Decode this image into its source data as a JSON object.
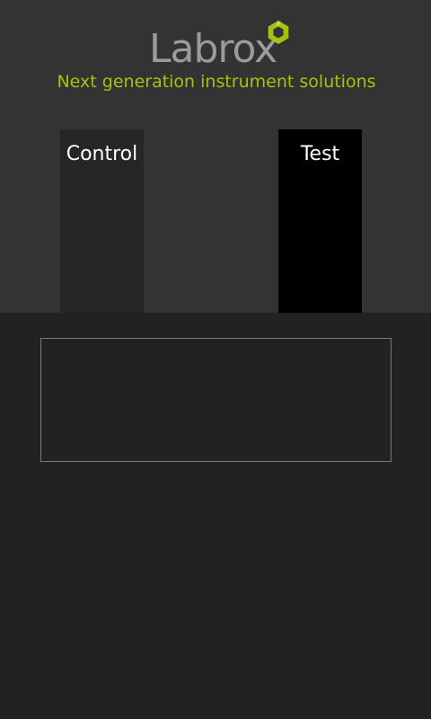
{
  "brand": {
    "name": "Labrox",
    "tagline": "Next generation instrument solutions",
    "accent_color": "#a9c00c",
    "logo_icon": "hexagon-logo-icon"
  },
  "columns": [
    {
      "label": "Control",
      "color": "#262626"
    },
    {
      "label": "Test",
      "color": "#000000"
    }
  ],
  "output": {
    "text": ""
  },
  "colors": {
    "header_bg": "#333333",
    "body_bg": "#222222"
  }
}
